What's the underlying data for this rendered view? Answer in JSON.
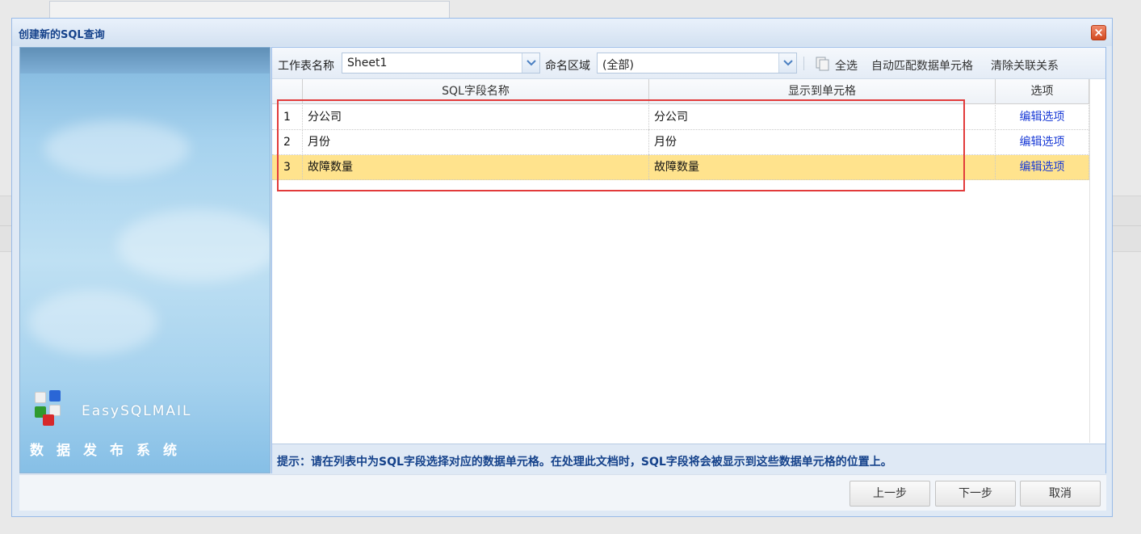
{
  "dialog": {
    "title": "创建新的SQL查询",
    "close_symbol": "×"
  },
  "brand": {
    "name": "EasySQLMAIL",
    "subtitle": "数据发布系统"
  },
  "toolbar": {
    "sheet_label": "工作表名称",
    "sheet_value": "Sheet1",
    "range_label": "命名区域",
    "range_value": "(全部)",
    "select_all": "全选",
    "auto_match": "自动匹配数据单元格",
    "clear_links": "清除关联关系"
  },
  "grid": {
    "headers": {
      "field": "SQL字段名称",
      "cell": "显示到单元格",
      "option": "选项"
    },
    "rows": [
      {
        "num": "1",
        "field": "分公司",
        "cell": "分公司",
        "option": "编辑选项"
      },
      {
        "num": "2",
        "field": "月份",
        "cell": "月份",
        "option": "编辑选项"
      },
      {
        "num": "3",
        "field": "故障数量",
        "cell": "故障数量",
        "option": "编辑选项"
      }
    ]
  },
  "hint": "提示：请在列表中为SQL字段选择对应的数据单元格。在处理此文档时，SQL字段将会被显示到这些数据单元格的位置上。",
  "footer": {
    "prev": "上一步",
    "next": "下一步",
    "cancel": "取消"
  },
  "colors": {
    "selected_row": "#ffe38d",
    "highlight": "#e23b3b",
    "link": "#1a3bd6",
    "title": "#15428b"
  }
}
